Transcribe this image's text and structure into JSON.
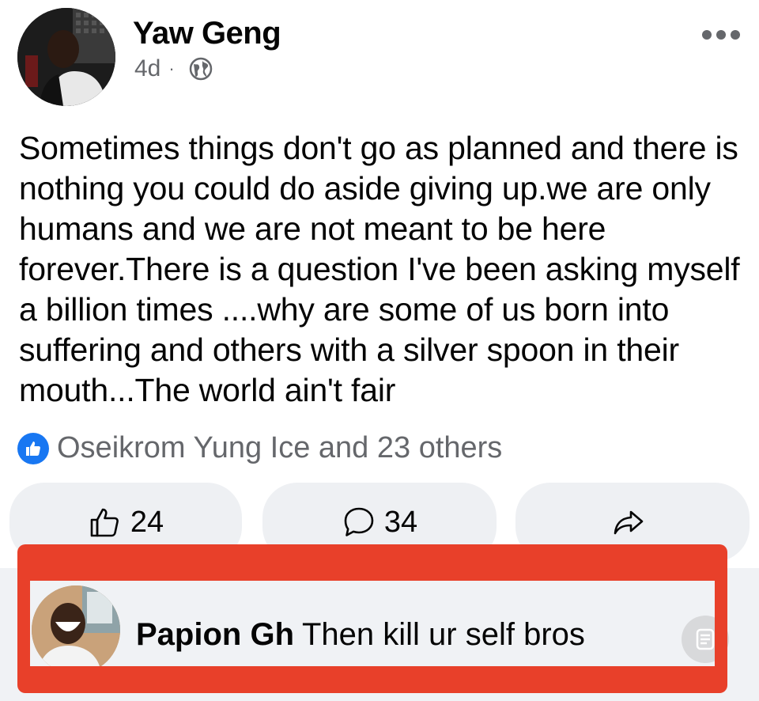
{
  "post": {
    "author": "Yaw Geng",
    "time": "4d",
    "separator": "·",
    "privacy_icon": "globe-icon",
    "more_icon": "more-options-icon",
    "text": "Sometimes things don't go as planned and there is nothing you could do aside giving up.we are only humans and we are not meant to be here forever.There is a question I've been asking myself a billion times ....why are some of us born into suffering and others with a silver spoon in their mouth...The world ain't fair"
  },
  "reactions": {
    "icon": "like-icon",
    "summary": "Oseikrom Yung Ice and 23 others"
  },
  "actions": {
    "like_count": "24",
    "comment_count": "34",
    "share_icon": "share-icon"
  },
  "comment": {
    "author": "Papion Gh",
    "text": "Then kill ur self bros"
  },
  "colors": {
    "accent": "#1877f2",
    "secondary_text": "#65676b",
    "highlight": "#e8402a",
    "button_bg": "#eef0f3"
  }
}
